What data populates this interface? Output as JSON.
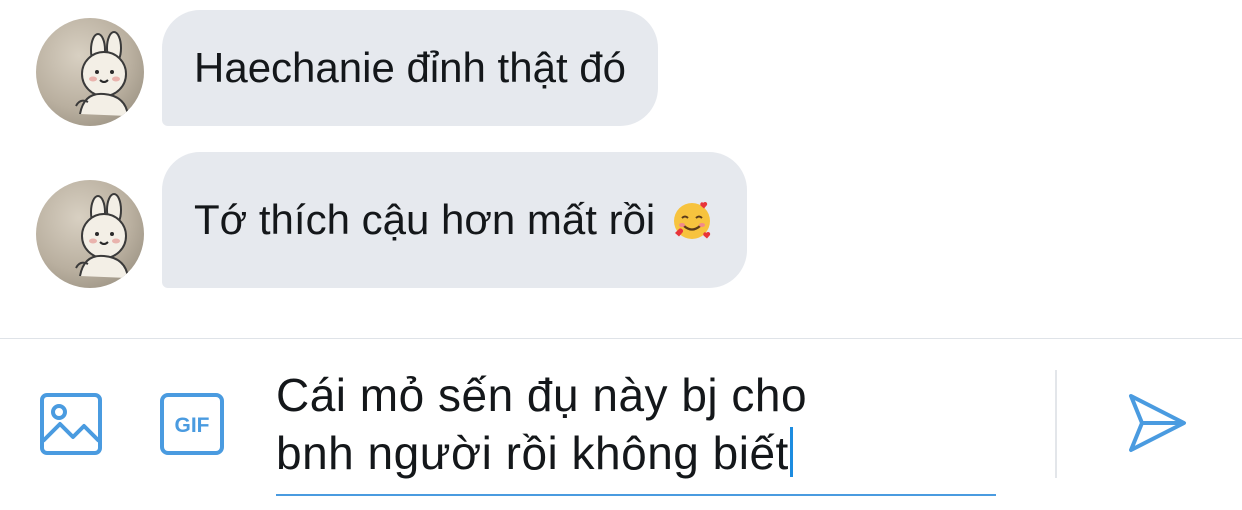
{
  "messages": [
    {
      "text": "Haechanie đỉnh thật đó",
      "emoji": ""
    },
    {
      "text": "Tớ thích cậu hơn mất rồi",
      "emoji": "smiling-face-with-hearts"
    }
  ],
  "composer": {
    "line1": "Cái mỏ sến đụ này bj cho",
    "line2": "bnh người rồi không biết"
  },
  "toolbar": {
    "image_icon": "image-icon",
    "gif_label": "GIF",
    "send_icon": "send-icon"
  },
  "colors": {
    "accent": "#4a9be0",
    "bubble": "#e6e9ee"
  }
}
